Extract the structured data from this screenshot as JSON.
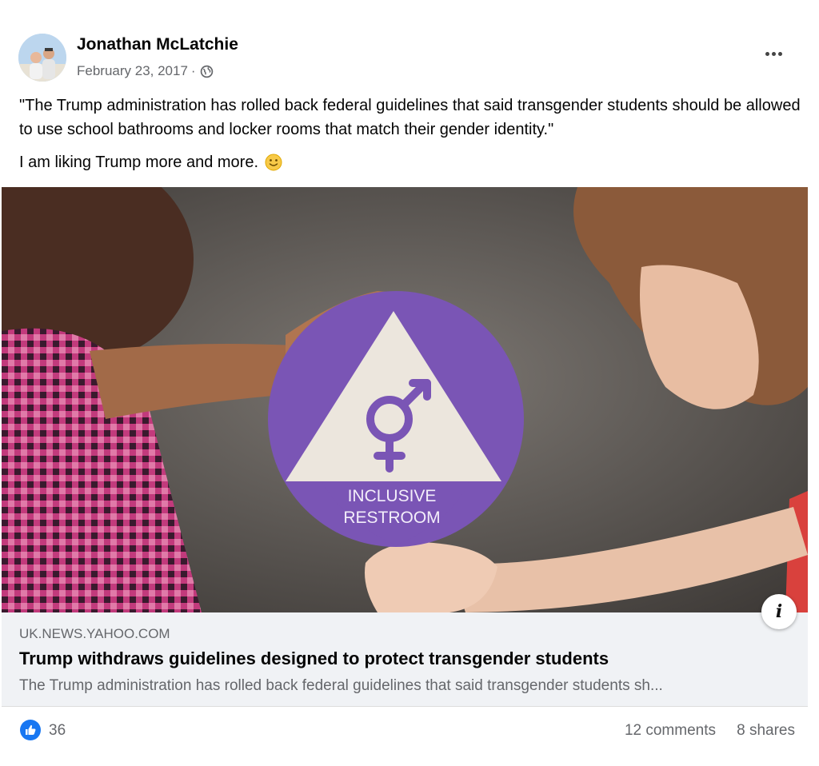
{
  "post": {
    "author": "Jonathan McLatchie",
    "date": "February 23, 2017",
    "date_separator": "·",
    "audience_icon": "globe-icon",
    "menu_icon": "more-options-icon",
    "text_quote": "\"The Trump administration has rolled back federal guidelines that said transgender students should be allowed to use school bathrooms and locker rooms that match their gender identity.\"",
    "text_comment": "I am liking Trump more and more.",
    "emoji": "slightly-smiling-face"
  },
  "link_preview": {
    "image_sign_line1": "INCLUSIVE",
    "image_sign_line2": "RESTROOM",
    "info_icon": "i",
    "domain": "UK.NEWS.YAHOO.COM",
    "title": "Trump withdraws guidelines designed to protect transgender students",
    "description": "The Trump administration has rolled back federal guidelines that said transgender students sh..."
  },
  "engagement": {
    "like_icon": "thumbs-up-icon",
    "reactions_count": "36",
    "comments": "12 comments",
    "shares": "8 shares"
  },
  "colors": {
    "facebook_blue": "#1877f2",
    "secondary_text": "#65676b",
    "sign_purple": "#7a55b5",
    "link_meta_bg": "#f0f2f5"
  }
}
